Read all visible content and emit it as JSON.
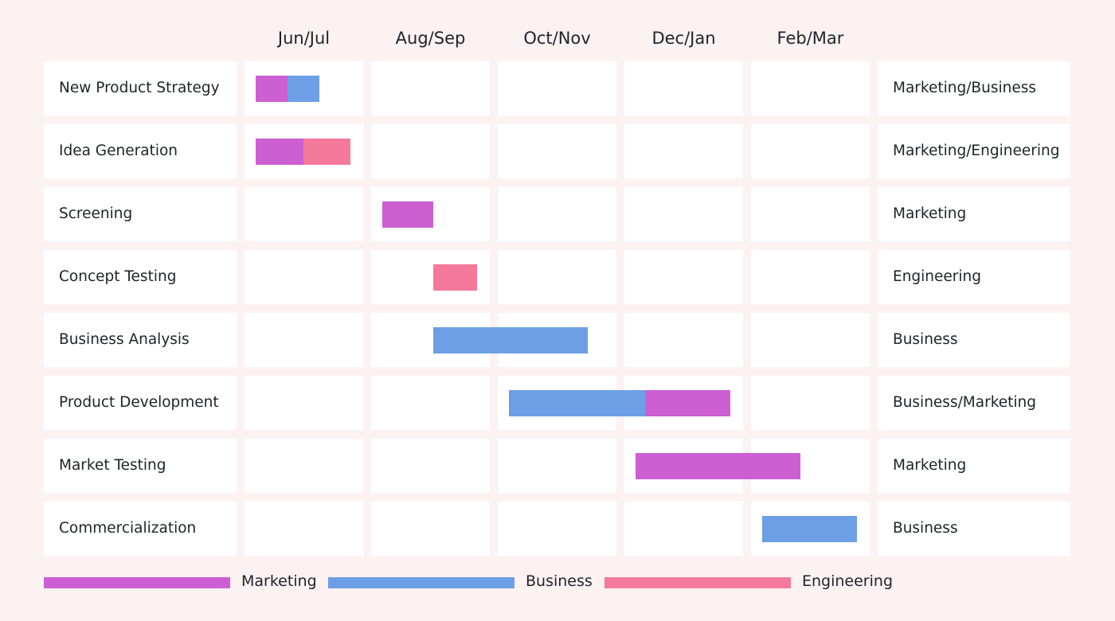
{
  "chart_data": {
    "type": "gantt",
    "title": "",
    "periods": [
      "Jun/Jul",
      "Aug/Sep",
      "Oct/Nov",
      "Dec/Jan",
      "Feb/Mar"
    ],
    "time_unit": "months from start of June",
    "x_range": [
      0,
      10
    ],
    "tasks": [
      {
        "name": "New Product Strategy",
        "owner": "Marketing/Business",
        "segments": [
          {
            "team": "Marketing",
            "start": 0,
            "end": 0.5
          },
          {
            "team": "Business",
            "start": 0.5,
            "end": 1.0
          }
        ]
      },
      {
        "name": "Idea Generation",
        "owner": "Marketing/Engineering",
        "segments": [
          {
            "team": "Marketing",
            "start": 0,
            "end": 0.75
          },
          {
            "team": "Engineering",
            "start": 0.75,
            "end": 1.5
          }
        ]
      },
      {
        "name": "Screening",
        "owner": "Marketing",
        "segments": [
          {
            "team": "Marketing",
            "start": 2.0,
            "end": 2.8
          }
        ]
      },
      {
        "name": "Concept Testing",
        "owner": "Engineering",
        "segments": [
          {
            "team": "Engineering",
            "start": 2.8,
            "end": 3.5
          }
        ]
      },
      {
        "name": "Business Analysis",
        "owner": "Business",
        "segments": [
          {
            "team": "Business",
            "start": 2.8,
            "end": 5.25
          }
        ]
      },
      {
        "name": "Product Development",
        "owner": "Business/Marketing",
        "segments": [
          {
            "team": "Business",
            "start": 4.0,
            "end": 6.15
          },
          {
            "team": "Marketing",
            "start": 6.15,
            "end": 7.5
          }
        ]
      },
      {
        "name": "Market Testing",
        "owner": "Marketing",
        "segments": [
          {
            "team": "Marketing",
            "start": 6.0,
            "end": 8.6
          }
        ]
      },
      {
        "name": "Commercialization",
        "owner": "Business",
        "segments": [
          {
            "team": "Business",
            "start": 8.0,
            "end": 9.5
          }
        ]
      }
    ],
    "legend": [
      {
        "name": "Marketing",
        "color": "#cc5fd2"
      },
      {
        "name": "Business",
        "color": "#6c9fe6"
      },
      {
        "name": "Engineering",
        "color": "#f4799b"
      }
    ],
    "legend_position": "bottom"
  }
}
